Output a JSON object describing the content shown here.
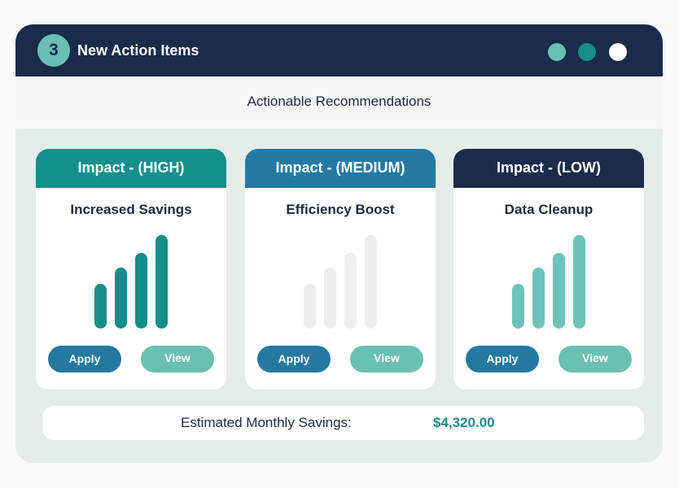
{
  "header": {
    "count": "3",
    "title": "New Action Items",
    "dot_colors": [
      "#6ac0b3",
      "#178e8a",
      "#ffffff"
    ]
  },
  "subheader": {
    "text": "Actionable Recommendations"
  },
  "cards": [
    {
      "impact_label": "Impact - (HIGH)",
      "header_color": "#13908c",
      "title": "Increased Savings",
      "bar_color": "#138e8a",
      "strength_bars_filled": 4,
      "apply_label": "Apply",
      "view_label": "View"
    },
    {
      "impact_label": "Impact - (MEDIUM)",
      "header_color": "#2479a3",
      "title": "Efficiency Boost",
      "bar_color": "#eeeeee",
      "strength_bars_filled": 0,
      "apply_label": "Apply",
      "view_label": "View"
    },
    {
      "impact_label": "Impact - (LOW)",
      "header_color": "#1a2b4c",
      "title": "Data Cleanup",
      "bar_color": "#6cc3b8",
      "strength_bars_filled": 4,
      "apply_label": "Apply",
      "view_label": "View"
    }
  ],
  "footer": {
    "label": "Estimated Monthly Savings:",
    "value": "$4,320.00"
  }
}
